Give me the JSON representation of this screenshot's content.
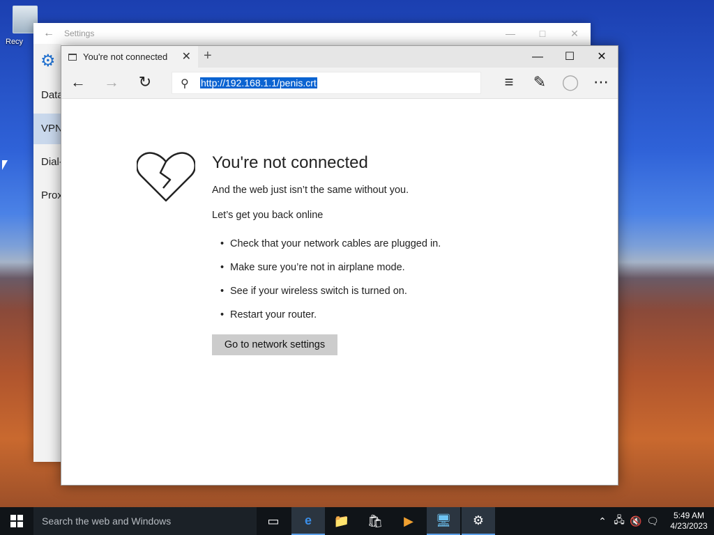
{
  "desktop": {
    "recycle_bin_label": "Recy"
  },
  "settings_window": {
    "title": "Settings",
    "nav_items": [
      {
        "label": "Data"
      },
      {
        "label": "VPN"
      },
      {
        "label": "Dial-"
      },
      {
        "label": "Prox"
      }
    ]
  },
  "browser": {
    "tab_title": "You're not connected",
    "address": "http://192.168.1.1/penis.crt",
    "content": {
      "heading": "You're not connected",
      "subtitle": "And the web just isn’t the same without you.",
      "lead": "Let’s get you back online",
      "tips": [
        "Check that your network cables are plugged in.",
        "Make sure you’re not in airplane mode.",
        "See if your wireless switch is turned on.",
        "Restart your router."
      ],
      "button_label": "Go to network settings"
    }
  },
  "taskbar": {
    "search_placeholder": "Search the web and Windows",
    "time": "5:49 AM",
    "date": "4/23/2023"
  },
  "colors": {
    "accent": "#0a63d1",
    "taskbar": "#101418",
    "settings_gear": "#1e6fcf"
  }
}
